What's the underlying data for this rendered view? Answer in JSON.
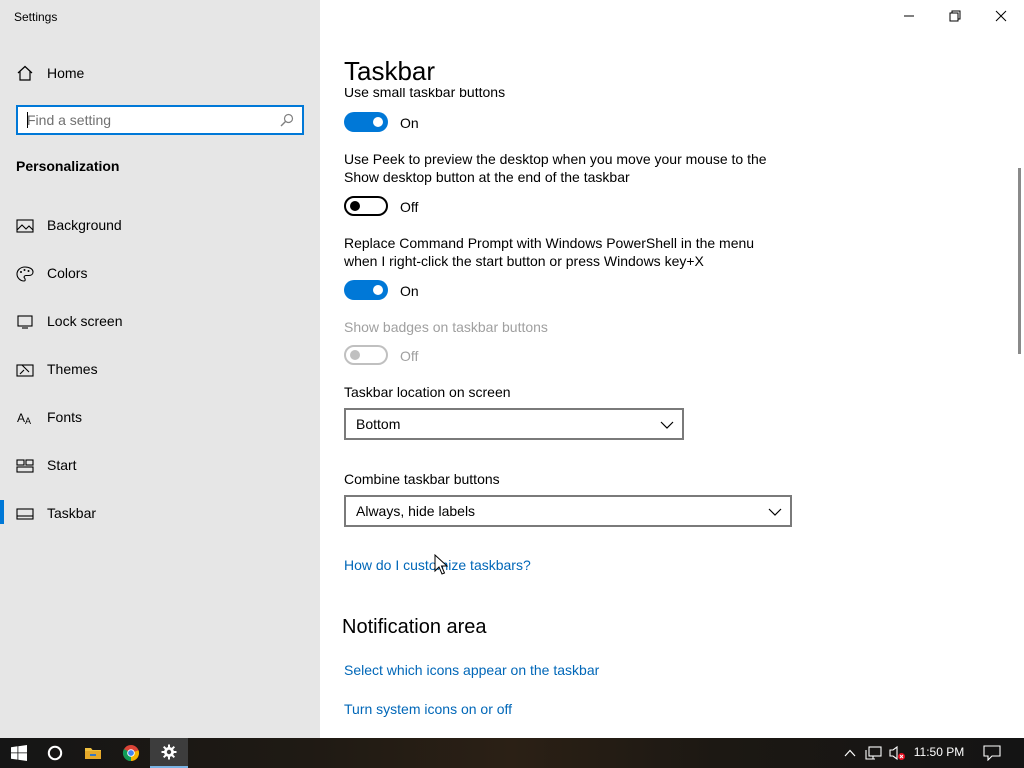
{
  "window": {
    "app_title": "Settings",
    "controls": {
      "minimize": "minimize",
      "maximize": "maximize",
      "close": "close"
    }
  },
  "sidebar": {
    "home_label": "Home",
    "search_placeholder": "Find a setting",
    "section_label": "Personalization",
    "items": [
      {
        "label": "Background",
        "icon": "image-icon"
      },
      {
        "label": "Colors",
        "icon": "palette-icon"
      },
      {
        "label": "Lock screen",
        "icon": "lock-screen-icon"
      },
      {
        "label": "Themes",
        "icon": "themes-icon"
      },
      {
        "label": "Fonts",
        "icon": "fonts-icon"
      },
      {
        "label": "Start",
        "icon": "start-icon"
      },
      {
        "label": "Taskbar",
        "icon": "taskbar-icon",
        "active": true
      }
    ]
  },
  "main": {
    "page_title": "Taskbar",
    "partial_label": "Use small taskbar buttons",
    "settings": [
      {
        "state": "On",
        "on": true
      },
      {
        "label_line1": "Use Peek to preview the desktop when you move your mouse to the",
        "label_line2": "Show desktop button at the end of the taskbar",
        "state": "Off",
        "on": false
      },
      {
        "label_line1": "Replace Command Prompt with Windows PowerShell in the menu",
        "label_line2": "when I right-click the start button or press Windows key+X",
        "state": "On",
        "on": true
      },
      {
        "label_line1": "Show badges on taskbar buttons",
        "state": "Off",
        "on": false,
        "disabled": true
      }
    ],
    "location_label": "Taskbar location on screen",
    "location_value": "Bottom",
    "combine_label": "Combine taskbar buttons",
    "combine_value": "Always, hide labels",
    "help_link": "How do I customize taskbars?",
    "notification_heading": "Notification area",
    "notification_links": [
      "Select which icons appear on the taskbar",
      "Turn system icons on or off"
    ]
  },
  "taskbar": {
    "clock": "11:50 PM",
    "accent": "#0078d7"
  }
}
